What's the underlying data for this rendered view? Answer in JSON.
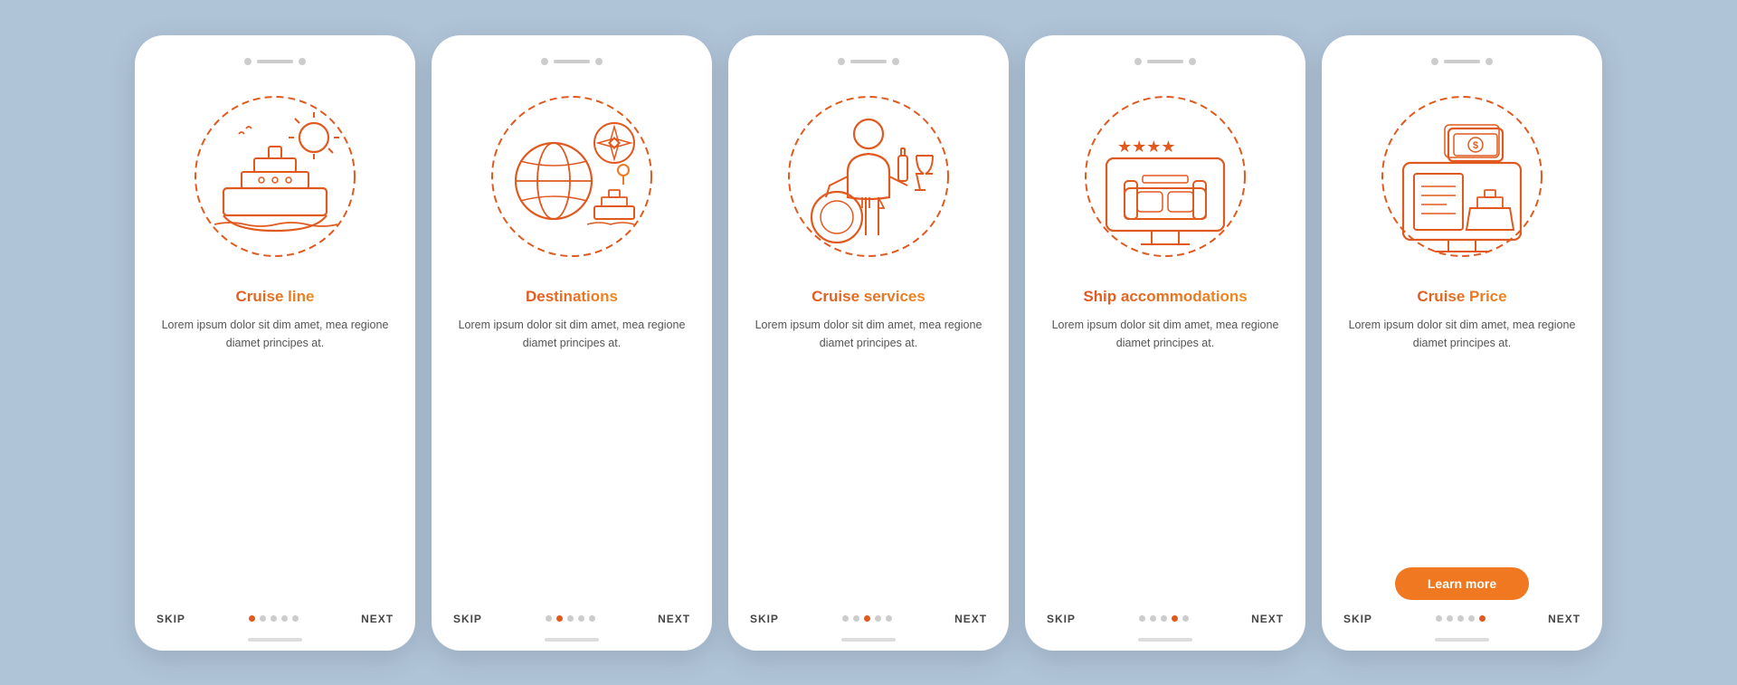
{
  "cards": [
    {
      "id": "cruise-line",
      "title": "Cruise line",
      "body": "Lorem ipsum dolor sit dim amet, mea regione diamet principes at.",
      "dots": [
        true,
        false,
        false,
        false,
        false
      ],
      "activeIndex": 0,
      "showLearnMore": false,
      "iconType": "cruise-ship"
    },
    {
      "id": "destinations",
      "title": "Destinations",
      "body": "Lorem ipsum dolor sit dim amet, mea regione diamet principes at.",
      "dots": [
        false,
        true,
        false,
        false,
        false
      ],
      "activeIndex": 1,
      "showLearnMore": false,
      "iconType": "destinations"
    },
    {
      "id": "cruise-services",
      "title": "Cruise services",
      "body": "Lorem ipsum dolor sit dim amet, mea regione diamet principes at.",
      "dots": [
        false,
        false,
        true,
        false,
        false
      ],
      "activeIndex": 2,
      "showLearnMore": false,
      "iconType": "services"
    },
    {
      "id": "ship-accommodations",
      "title": "Ship accommodations",
      "body": "Lorem ipsum dolor sit dim amet, mea regione diamet principes at.",
      "dots": [
        false,
        false,
        false,
        true,
        false
      ],
      "activeIndex": 3,
      "showLearnMore": false,
      "iconType": "accommodations"
    },
    {
      "id": "cruise-price",
      "title": "Cruise Price",
      "body": "Lorem ipsum dolor sit dim amet, mea regione diamet principes at.",
      "dots": [
        false,
        false,
        false,
        false,
        true
      ],
      "activeIndex": 4,
      "showLearnMore": true,
      "iconType": "price"
    }
  ],
  "nav": {
    "skip_label": "SKIP",
    "next_label": "NEXT",
    "learn_more_label": "Learn more"
  }
}
